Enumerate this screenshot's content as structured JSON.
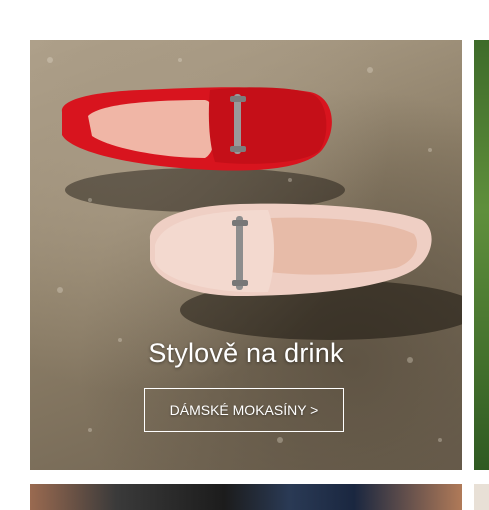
{
  "banner": {
    "headline": "Stylově na drink",
    "cta_label": "DÁMSKÉ MOKASÍNY >",
    "image_subject": "red-and-beige-loafers"
  },
  "colors": {
    "red_shoe": "#d8141e",
    "beige_shoe": "#efcfc4",
    "buckle": "#8d8d8d",
    "text": "#ffffff"
  }
}
